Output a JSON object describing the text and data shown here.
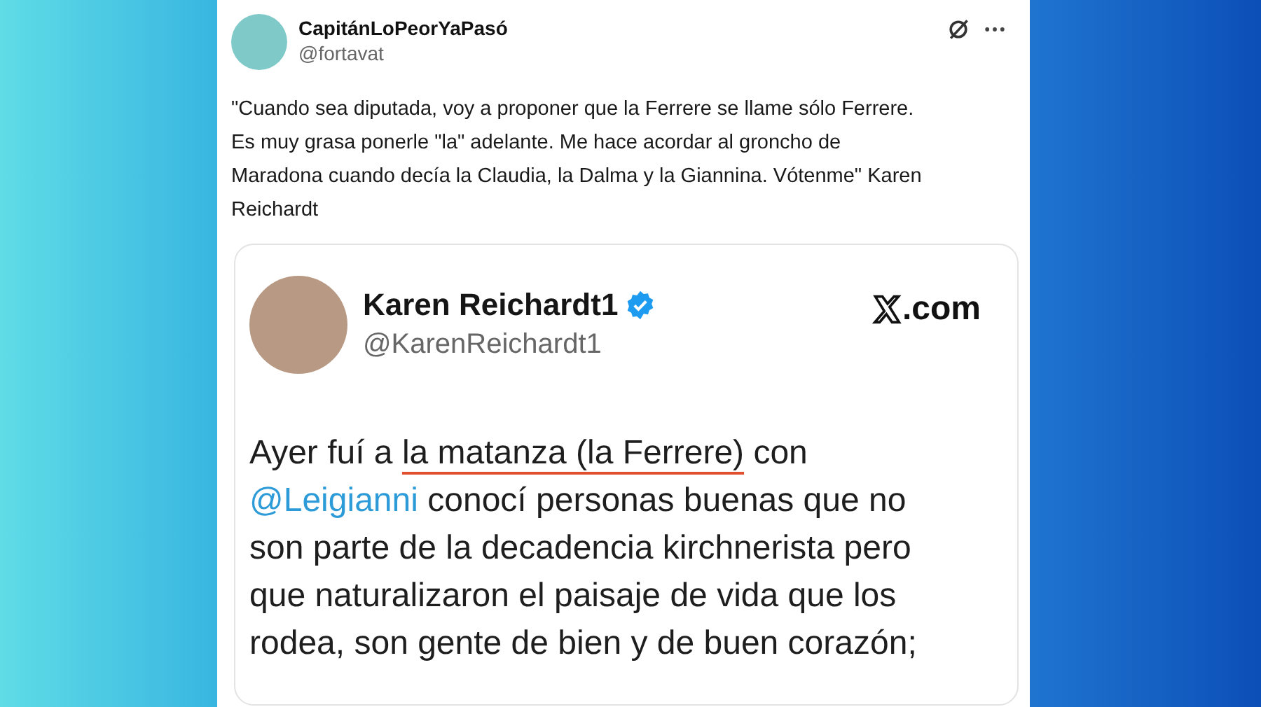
{
  "post": {
    "author": {
      "name": "CapitánLoPeorYaPasó",
      "handle": "@fortavat"
    },
    "text_lines": [
      "\"Cuando sea diputada, voy a proponer que la Ferrere se llame sólo Ferrere.",
      "Es muy grasa ponerle \"la\" adelante. Me hace acordar al groncho de",
      "Maradona cuando decía la Claudia, la Dalma y la Giannina. Vótenme\" Karen",
      "Reichardt"
    ],
    "quoted": {
      "name": "Karen Reichardt1",
      "verified": true,
      "handle": "@KarenReichardt1",
      "site": ".com",
      "lines": [
        [
          {
            "kind": "plain",
            "text": "Ayer fuí a "
          },
          {
            "kind": "underlined",
            "text": "la matanza (la Ferrere)"
          },
          {
            "kind": "plain",
            "text": " con"
          }
        ],
        [
          {
            "kind": "mention",
            "text": "@Leigianni"
          },
          {
            "kind": "plain",
            "text": " conocí personas buenas que no"
          }
        ],
        [
          {
            "kind": "plain",
            "text": "son parte de la decadencia kirchnerista pero"
          }
        ],
        [
          {
            "kind": "plain",
            "text": "que naturalizaron el paisaje de vida que los"
          }
        ],
        [
          {
            "kind": "plain",
            "text": "rodea, son gente de bien y de buen corazón;"
          }
        ]
      ]
    }
  }
}
